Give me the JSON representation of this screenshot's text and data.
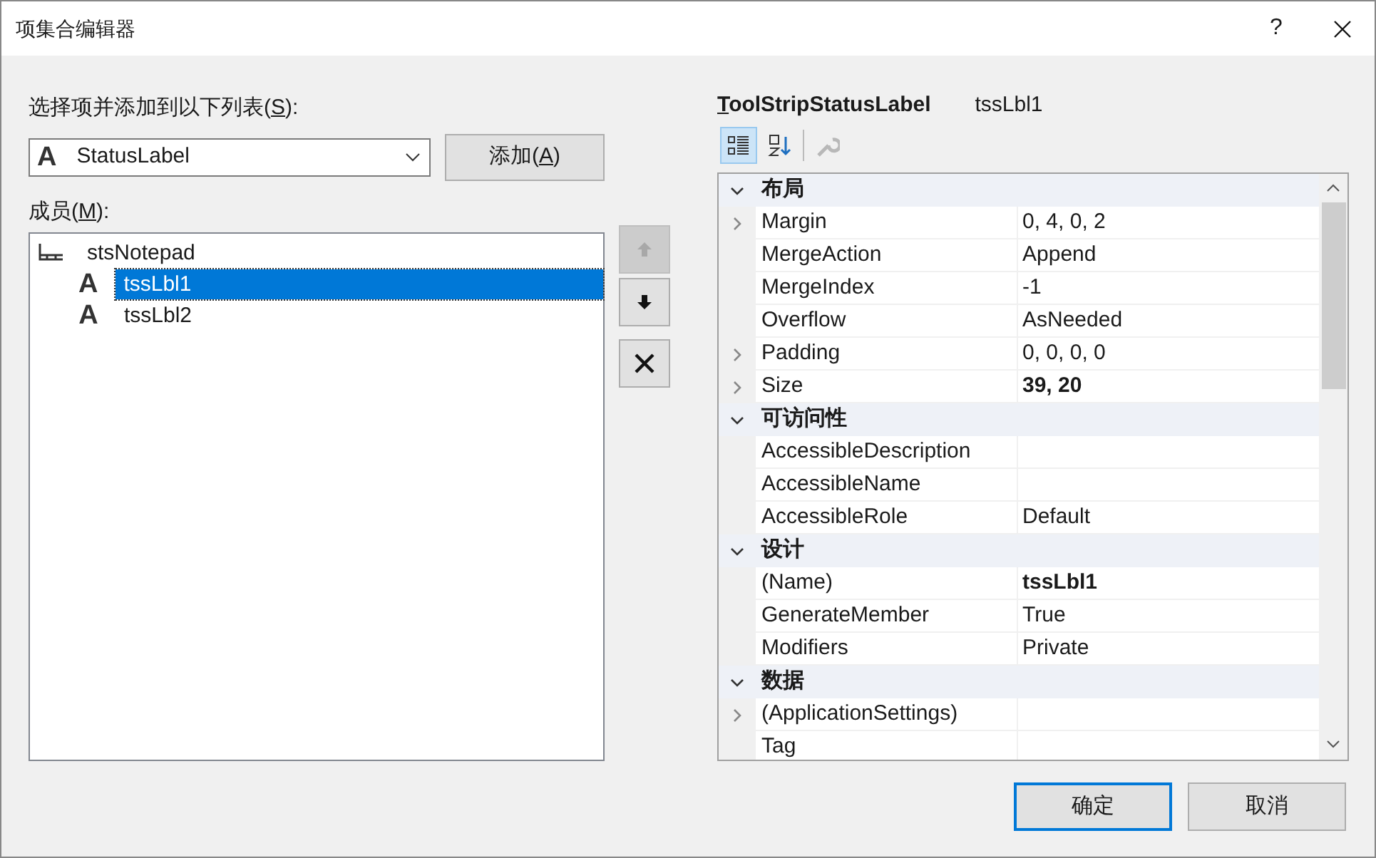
{
  "window": {
    "title": "项集合编辑器",
    "help": "?"
  },
  "add_section": {
    "label": {
      "before": "选择项并添加到以下列表(",
      "key": "S",
      "after": "):"
    },
    "combo": {
      "icon": "A",
      "value": "StatusLabel"
    },
    "add_button": {
      "before": "添加(",
      "key": "A",
      "after": ")"
    }
  },
  "members": {
    "label": {
      "before": "成员(",
      "key": "M",
      "after": "):"
    },
    "tree": [
      {
        "kind": "strip",
        "label": "stsNotepad",
        "selected": false,
        "children": [
          {
            "kind": "label",
            "icon": "A",
            "label": "tssLbl1",
            "selected": true
          },
          {
            "kind": "label",
            "icon": "A",
            "label": "tssLbl2",
            "selected": false
          }
        ]
      }
    ]
  },
  "move_buttons": [
    {
      "kind": "up",
      "disabled": true
    },
    {
      "kind": "down",
      "disabled": false
    },
    {
      "kind": "delete",
      "disabled": false
    }
  ],
  "properties": {
    "type_name": {
      "key": "T",
      "after": "oolStripStatusLabel"
    },
    "object_name": "tssLbl1",
    "toolbar": [
      {
        "kind": "categorized",
        "selected": true,
        "disabled": false
      },
      {
        "kind": "alphabetical",
        "selected": false,
        "disabled": false
      },
      {
        "kind": "property-pages",
        "selected": false,
        "disabled": true
      }
    ],
    "grid": [
      {
        "category": "布局",
        "expanded": true,
        "rows": [
          {
            "name": "Margin",
            "value": "0, 4, 0, 2",
            "expandable": true,
            "modified": false
          },
          {
            "name": "MergeAction",
            "value": "Append",
            "expandable": false,
            "modified": false
          },
          {
            "name": "MergeIndex",
            "value": "-1",
            "expandable": false,
            "modified": false
          },
          {
            "name": "Overflow",
            "value": "AsNeeded",
            "expandable": false,
            "modified": false
          },
          {
            "name": "Padding",
            "value": "0, 0, 0, 0",
            "expandable": true,
            "modified": false
          },
          {
            "name": "Size",
            "value": "39, 20",
            "expandable": true,
            "modified": true
          }
        ]
      },
      {
        "category": "可访问性",
        "expanded": true,
        "rows": [
          {
            "name": "AccessibleDescription",
            "expandable": false
          },
          {
            "name": "AccessibleName",
            "expandable": false
          },
          {
            "name": "AccessibleRole",
            "value": "Default",
            "expandable": false,
            "modified": false
          }
        ]
      },
      {
        "category": "设计",
        "expanded": true,
        "rows": [
          {
            "name": "(Name)",
            "value": "tssLbl1",
            "expandable": false,
            "modified": true
          },
          {
            "name": "GenerateMember",
            "value": "True",
            "expandable": false,
            "modified": false
          },
          {
            "name": "Modifiers",
            "value": "Private",
            "expandable": false,
            "modified": false
          }
        ]
      },
      {
        "category": "数据",
        "expanded": true,
        "rows": [
          {
            "name": "(ApplicationSettings)",
            "expandable": true
          },
          {
            "name": "Tag",
            "expandable": false
          }
        ]
      }
    ]
  },
  "buttons": [
    {
      "label": "确定",
      "default": true
    },
    {
      "label": "取消",
      "default": false
    }
  ]
}
